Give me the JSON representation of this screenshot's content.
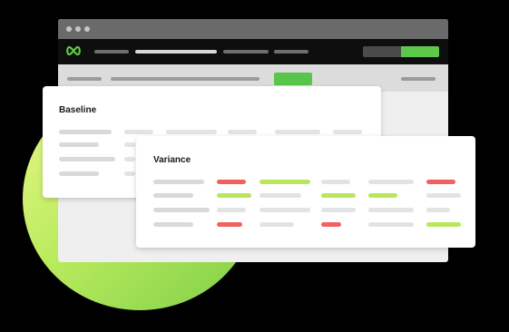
{
  "cards": {
    "baseline": {
      "title": "Baseline"
    },
    "variance": {
      "title": "Variance"
    }
  },
  "icons": {
    "logo": "infinity-logo-icon"
  },
  "colors": {
    "accent_green": "#5ec84a",
    "lime": "#b9e65a",
    "red": "#f0625f",
    "ring_start": "#e9f88a",
    "ring_end": "#7fcf48"
  }
}
